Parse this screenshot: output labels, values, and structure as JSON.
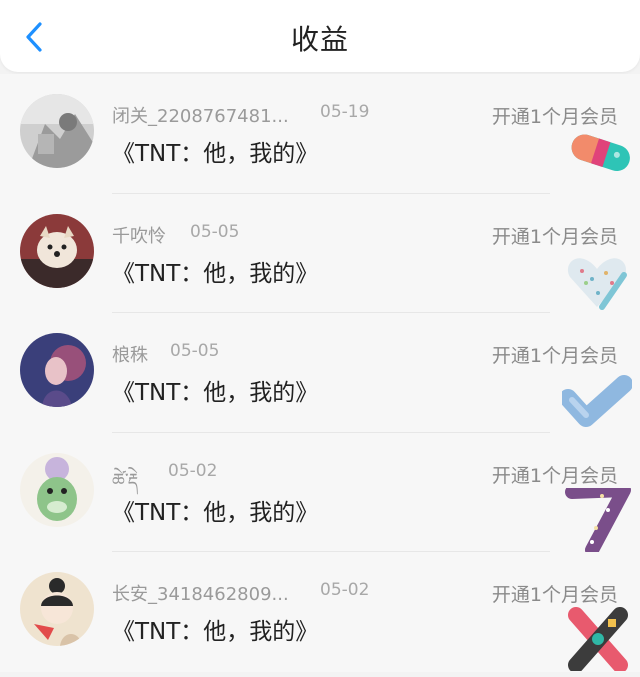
{
  "header": {
    "title": "收益"
  },
  "colors": {
    "accent": "#1e90ff"
  },
  "icons": {
    "back": "chevron-left-icon"
  },
  "items": [
    {
      "name": "闭关_2208767481...",
      "date": "05-19",
      "product": "《TNT：他，我的》",
      "reward": "开通1个月会员",
      "gift_icon": "pill-gift-icon"
    },
    {
      "name": "千吹怜",
      "date": "05-05",
      "product": "《TNT：他，我的》",
      "reward": "开通1个月会员",
      "gift_icon": "heart-gift-icon"
    },
    {
      "name": "桹秼",
      "date": "05-05",
      "product": "《TNT：他，我的》",
      "reward": "开通1个月会员",
      "gift_icon": "check-gift-icon"
    },
    {
      "name": "ཚེ་རྡེ",
      "date": "05-02",
      "product": "《TNT：他，我的》",
      "reward": "开通1个月会员",
      "gift_icon": "seven-gift-icon"
    },
    {
      "name": "长安_3418462809...",
      "date": "05-02",
      "product": "《TNT：他，我的》",
      "reward": "开通1个月会员",
      "gift_icon": "x-gift-icon"
    }
  ]
}
